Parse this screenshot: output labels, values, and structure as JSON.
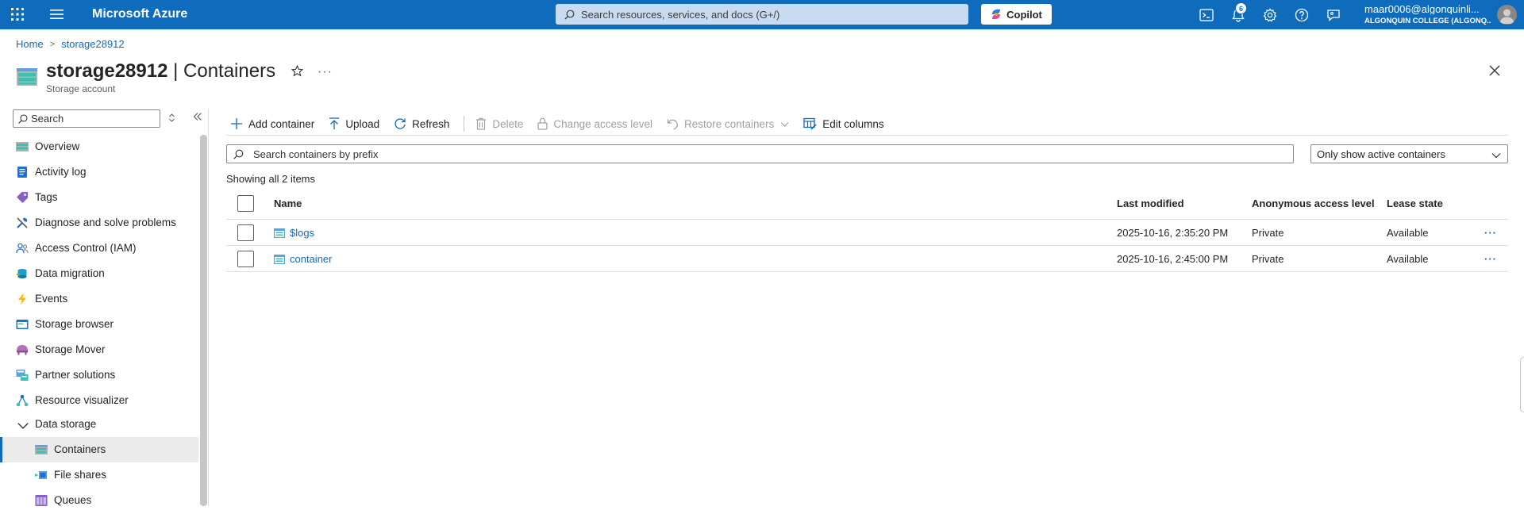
{
  "topbar": {
    "brand": "Microsoft Azure",
    "search_placeholder": "Search resources, services, and docs (G+/)",
    "copilot_label": "Copilot",
    "notification_count": "6",
    "user_email": "maar0006@algonquinli...",
    "user_org": "ALGONQUIN COLLEGE (ALGONQ..."
  },
  "breadcrumb": {
    "home": "Home",
    "current": "storage28912"
  },
  "header": {
    "resource_name": "storage28912",
    "separator": " | ",
    "page": "Containers",
    "subtitle": "Storage account"
  },
  "sidebar": {
    "search_placeholder": "Search",
    "items": [
      {
        "label": "Overview",
        "icon": "overview-icon"
      },
      {
        "label": "Activity log",
        "icon": "activity-log-icon"
      },
      {
        "label": "Tags",
        "icon": "tag-icon"
      },
      {
        "label": "Diagnose and solve problems",
        "icon": "wrench-icon"
      },
      {
        "label": "Access Control (IAM)",
        "icon": "people-icon"
      },
      {
        "label": "Data migration",
        "icon": "migration-icon"
      },
      {
        "label": "Events",
        "icon": "lightning-icon"
      },
      {
        "label": "Storage browser",
        "icon": "storage-browser-icon"
      },
      {
        "label": "Storage Mover",
        "icon": "storage-mover-icon"
      },
      {
        "label": "Partner solutions",
        "icon": "partner-icon"
      },
      {
        "label": "Resource visualizer",
        "icon": "visualizer-icon"
      }
    ],
    "group": {
      "label": "Data storage",
      "icon": "chevron-down-icon"
    },
    "sub_items": [
      {
        "label": "Containers",
        "icon": "container-icon",
        "active": true
      },
      {
        "label": "File shares",
        "icon": "file-share-icon"
      },
      {
        "label": "Queues",
        "icon": "queue-icon"
      }
    ]
  },
  "toolbar": {
    "add_container": "Add container",
    "upload": "Upload",
    "refresh": "Refresh",
    "delete": "Delete",
    "change_access": "Change access level",
    "restore": "Restore containers",
    "edit_columns": "Edit columns"
  },
  "filter": {
    "search_placeholder": "Search containers by prefix",
    "select_value": "Only show active containers"
  },
  "showing": "Showing all 2 items",
  "table": {
    "columns": {
      "name": "Name",
      "modified": "Last modified",
      "anon": "Anonymous access level",
      "lease": "Lease state"
    },
    "rows": [
      {
        "name": "$logs",
        "modified": "2025-10-16, 2:35:20 PM",
        "anon": "Private",
        "lease": "Available",
        "more": "···"
      },
      {
        "name": "container",
        "modified": "2025-10-16, 2:45:00 PM",
        "anon": "Private",
        "lease": "Available",
        "more": "···"
      }
    ]
  },
  "colors": {
    "topbar": "#0f6cbd",
    "link": "#0f6cbd",
    "disabled": "#a19f9d"
  }
}
